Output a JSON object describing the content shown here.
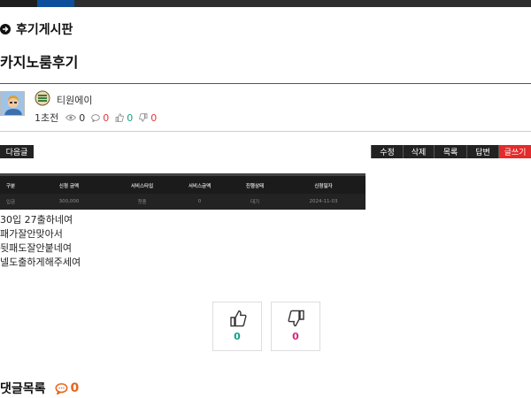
{
  "board": {
    "title": "후기게시판",
    "icon": "arrow-circle-icon"
  },
  "post": {
    "title": "카지노룸후기",
    "author": "티원에이",
    "time": "1초전",
    "views": "0",
    "comments": "0",
    "likes": "0",
    "dislikes": "0",
    "avatar_icon": "user-avatar-icon",
    "level_icon": "level-badge-icon"
  },
  "buttons": {
    "next": "다음글",
    "edit": "수정",
    "delete": "삭제",
    "list": "목록",
    "reply": "답변",
    "write": "글쓰기"
  },
  "embedded_table": {
    "headers": [
      "구분",
      "신청 금액",
      "서비스타입",
      "서비스금액",
      "진행상태",
      "신청일자"
    ],
    "row": [
      "입금",
      "300,000",
      "첫충",
      "0",
      "대기",
      "2024-11-03"
    ]
  },
  "body_lines": [
    "30입 27출하네여",
    "패가잘안맞아서",
    "뒷패도잘안붙네여",
    "넬도출하게해주세여"
  ],
  "votes": {
    "up_count": "0",
    "down_count": "0"
  },
  "comments_section": {
    "title": "댓글목록",
    "count": "0"
  },
  "colors": {
    "accent_red": "#e42a2a",
    "green": "#14a085",
    "pink": "#d3267a",
    "orange": "#e8661c",
    "header_blue": "#0d4f9c"
  }
}
